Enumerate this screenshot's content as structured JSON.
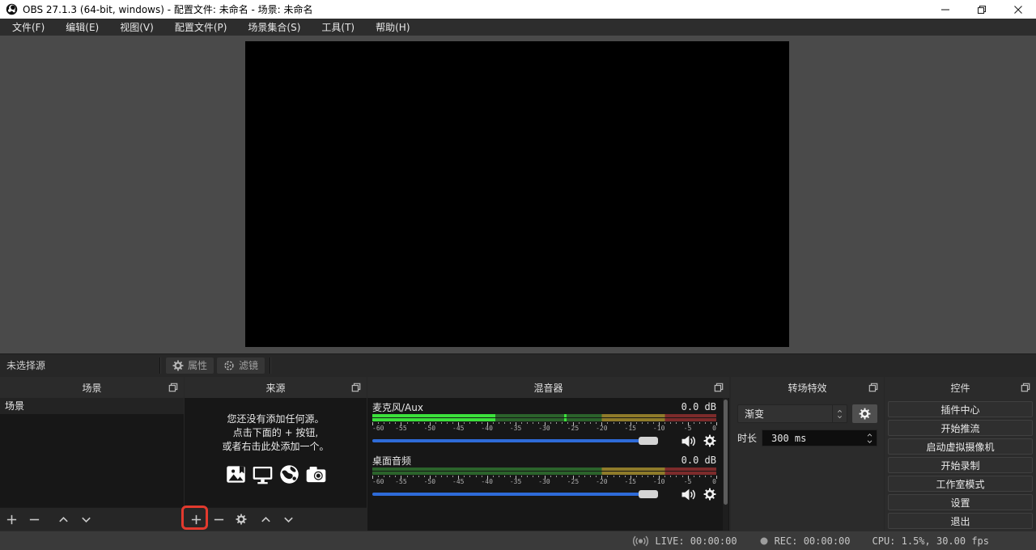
{
  "window": {
    "title": "OBS 27.1.3 (64-bit, windows) - 配置文件: 未命名 - 场景: 未命名"
  },
  "menu": {
    "items": [
      "文件(F)",
      "编辑(E)",
      "视图(V)",
      "配置文件(P)",
      "场景集合(S)",
      "工具(T)",
      "帮助(H)"
    ]
  },
  "source_toolbar": {
    "no_source_label": "未选择源",
    "properties_label": "属性",
    "filters_label": "滤镜"
  },
  "scenes": {
    "title": "场景",
    "items": [
      "场景"
    ]
  },
  "sources": {
    "title": "来源",
    "empty_lines": [
      "您还没有添加任何源。",
      "点击下面的 + 按钮,",
      "或者右击此处添加一个。"
    ]
  },
  "mixer": {
    "title": "混音器",
    "scale_labels": [
      "-60",
      "-55",
      "-50",
      "-45",
      "-40",
      "-35",
      "-30",
      "-25",
      "-20",
      "-15",
      "-10",
      "-5",
      "0"
    ],
    "meter": {
      "warn_db": -20,
      "error_db": -9,
      "bright_green": "#3be13b",
      "dim_green": "#2b632b",
      "dim_yellow": "#8f7b2a",
      "dim_red": "#7d2b2b"
    },
    "channels": [
      {
        "name": "麦克风/Aux",
        "db_label": "0.0 dB",
        "level_db": -38.5,
        "peak_db": -26.5,
        "volume_pct": 95
      },
      {
        "name": "桌面音频",
        "db_label": "0.0 dB",
        "level_db": -60,
        "peak_db": null,
        "volume_pct": 95
      }
    ]
  },
  "transitions": {
    "title": "转场特效",
    "selected": "渐变",
    "duration_label": "时长",
    "duration_value": "300 ms"
  },
  "controls": {
    "title": "控件",
    "buttons": [
      "插件中心",
      "开始推流",
      "启动虚拟摄像机",
      "开始录制",
      "工作室模式",
      "设置",
      "退出"
    ]
  },
  "statusbar": {
    "live": "LIVE: 00:00:00",
    "rec": "REC: 00:00:00",
    "cpu": "CPU: 1.5%, 30.00 fps"
  },
  "annotation": {
    "highlight_color": "#e23a2e",
    "target": "add-source-button"
  },
  "icons": {
    "titlebar": [
      "obs-logo",
      "minimize-icon",
      "restore-icon",
      "close-icon"
    ],
    "panel_header": "popout-icon",
    "toolbar": [
      "gear-icon",
      "filters-icon"
    ],
    "sources_empty": [
      "image-icon",
      "display-icon",
      "globe-icon",
      "camera-icon"
    ],
    "mixer": [
      "speaker-icon",
      "gear-icon"
    ],
    "list_toolbar": [
      "plus-icon",
      "minus-icon",
      "gear-icon",
      "chevron-up-icon",
      "chevron-down-icon"
    ],
    "status": [
      "broadcast-icon",
      "record-dot-icon"
    ]
  }
}
